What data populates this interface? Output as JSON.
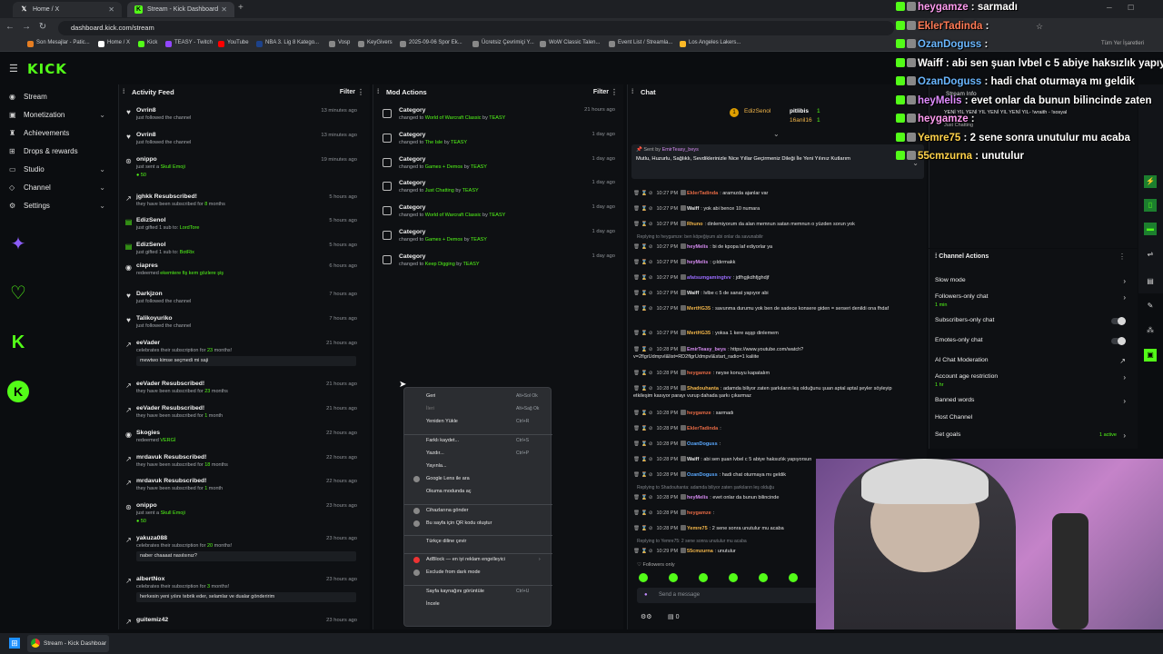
{
  "browser": {
    "tabs": [
      {
        "title": "Home / X",
        "icon": "x-icon",
        "active": false
      },
      {
        "title": "Stream - Kick Dashboard",
        "icon": "kick-icon",
        "active": true
      }
    ],
    "url": "dashboard.kick.com/stream",
    "bookmarks": [
      "Son Mesajlar - Patic...",
      "Home / X",
      "Kick",
      "TEASY - Twitch",
      "YouTube",
      "NBA 3. Lig 8 Katego...",
      "Vosp",
      "KeyGivers",
      "2025-09-06 Spor Ek...",
      "Ücretsiz Çevrimiçi Y...",
      "WoW Classic Talen...",
      "Event List / Streamla...",
      "Los Angeles Lakers..."
    ],
    "bookmarks_right": "Tüm Yer İşaretleri"
  },
  "app": {
    "logo": "KICK"
  },
  "sidebar": {
    "items": [
      {
        "label": "Stream",
        "icon": "stream-icon"
      },
      {
        "label": "Monetization",
        "icon": "money-icon"
      },
      {
        "label": "Achievements",
        "icon": "trophy-icon"
      },
      {
        "label": "Drops & rewards",
        "icon": "gift-icon"
      },
      {
        "label": "Studio",
        "icon": "studio-icon"
      },
      {
        "label": "Channel",
        "icon": "channel-icon"
      },
      {
        "label": "Settings",
        "icon": "gear-icon"
      }
    ]
  },
  "activity": {
    "title": "Activity Feed",
    "filter": "Filter",
    "items": [
      {
        "name": "Ovrin8",
        "sub": "just followed the channel",
        "time": "13 minutes ago",
        "icon": "heart"
      },
      {
        "name": "Ovrin8",
        "sub": "just followed the channel",
        "time": "13 minutes ago",
        "icon": "heart"
      },
      {
        "name": "onippo",
        "sub": "just sent a ",
        "hl": "Skull Emoji",
        "gift": "50",
        "time": "19 minutes ago",
        "icon": "kick"
      },
      {
        "name": "jghkk Resubscribed!",
        "sub": "they have been subscribed for ",
        "hl": "8",
        "sub2": " months",
        "time": "5 hours ago",
        "icon": "star"
      },
      {
        "name": "EdizSenol",
        "sub": "just gifted 1 sub to: ",
        "hl": "LordTore",
        "time": "5 hours ago",
        "icon": "gift"
      },
      {
        "name": "EdizSenol",
        "sub": "just gifted 1 sub to: ",
        "hl": "BotRix",
        "time": "5 hours ago",
        "icon": "gift"
      },
      {
        "name": "ciapres",
        "sub": "redeemed ",
        "hl": "ekemtere fiş kem gözlere şiş",
        "time": "6 hours ago",
        "icon": "redeem"
      },
      {
        "name": "Darkjzon",
        "sub": "just followed the channel",
        "time": "7 hours ago",
        "icon": "heart"
      },
      {
        "name": "Talikoyuriko",
        "sub": "just followed the channel",
        "time": "7 hours ago",
        "icon": "heart"
      },
      {
        "name": "eeVader",
        "sub": "celebrates their subscription for ",
        "hl": "23",
        "sub2": " months!",
        "msg": "mewtwo kimse seçmedi mi saji",
        "time": "21 hours ago",
        "icon": "star"
      },
      {
        "name": "eeVader Resubscribed!",
        "sub": "they have been subscribed for ",
        "hl": "23",
        "sub2": " months",
        "time": "21 hours ago",
        "icon": "star"
      },
      {
        "name": "eeVader Resubscribed!",
        "sub": "they have been subscribed for ",
        "hl": "1",
        "sub2": " month",
        "time": "21 hours ago",
        "icon": "star"
      },
      {
        "name": "Skogies",
        "sub": "redeemed ",
        "hl": "VERGİ",
        "time": "22 hours ago",
        "icon": "redeem"
      },
      {
        "name": "mrdavuk Resubscribed!",
        "sub": "they have been subscribed for ",
        "hl": "18",
        "sub2": " months",
        "time": "22 hours ago",
        "icon": "star"
      },
      {
        "name": "mrdavuk Resubscribed!",
        "sub": "they have been subscribed for ",
        "hl": "1",
        "sub2": " month",
        "time": "22 hours ago",
        "icon": "star"
      },
      {
        "name": "onippo",
        "sub": "just sent a ",
        "hl": "Skull Emoji",
        "gift": "50",
        "time": "23 hours ago",
        "icon": "kick"
      },
      {
        "name": "yakuza088",
        "sub": "celebrates their subscription for ",
        "hl": "20",
        "sub2": " months!",
        "msg": "naber chaaaat nasılsınız?",
        "time": "23 hours ago",
        "icon": "star"
      },
      {
        "name": "albertNox",
        "sub": "celebrates their subscription for ",
        "hl": "3",
        "sub2": " months!",
        "msg": "herkesin yeni yılını tebrik eder, selamlar ve dualar gönderirim",
        "time": "23 hours ago",
        "icon": "star"
      },
      {
        "name": "guitemiz42",
        "sub": "",
        "time": "23 hours ago",
        "icon": "star"
      }
    ]
  },
  "mod": {
    "title": "Mod Actions",
    "filter": "Filter",
    "items": [
      {
        "name": "Category",
        "pre": "changed to ",
        "cat": "World of Warcraft Classic",
        "by": " by ",
        "user": "TEASY",
        "time": "21 hours ago"
      },
      {
        "name": "Category",
        "pre": "changed to ",
        "cat": "The Isle",
        "by": " by ",
        "user": "TEASY",
        "time": "1 day ago"
      },
      {
        "name": "Category",
        "pre": "changed to ",
        "cat": "Games + Demos",
        "by": " by ",
        "user": "TEASY",
        "time": "1 day ago"
      },
      {
        "name": "Category",
        "pre": "changed to ",
        "cat": "Just Chatting",
        "by": " by ",
        "user": "TEASY",
        "time": "1 day ago"
      },
      {
        "name": "Category",
        "pre": "changed to ",
        "cat": "World of Warcraft Classic",
        "by": " by ",
        "user": "TEASY",
        "time": "1 day ago"
      },
      {
        "name": "Category",
        "pre": "changed to ",
        "cat": "Games + Demos",
        "by": " by ",
        "user": "TEASY",
        "time": "1 day ago"
      },
      {
        "name": "Category",
        "pre": "changed to ",
        "cat": "Keep Digging",
        "by": " by ",
        "user": "TEASY",
        "time": "1 day ago"
      }
    ]
  },
  "chat": {
    "title": "Chat",
    "pinned": {
      "sentby": "Sent by",
      "user": "EmirTeasy_beys",
      "text": "Mutlu, Huzurlu, Sağlıklı, Sevdiklerinizle Nice Yıllar Geçirmeniz Dileği İle Yeni Yılınız Kutlarım"
    },
    "top_users": {
      "a": "EdizSenol",
      "b": "pitlibis",
      "c": "16anil16",
      "n1": "1",
      "n2": "1"
    },
    "lines": [
      {
        "time": "10:27 PM",
        "user": "EklerTadinda",
        "color": "#e66a45",
        "text": "aramızda ajanlar var"
      },
      {
        "time": "10:27 PM",
        "user": "Waiff",
        "color": "#e6e6e6",
        "text": "yok abi bence 10 numara"
      },
      {
        "time": "10:27 PM",
        "user": "Rhuno",
        "color": "#f2b64a",
        "text": "dinlemiyorum da alan memnun satan memnun o yüzden sorun yok"
      },
      {
        "reply": "Replying to heygamze: ben köpeğiyum abi onlar da savunabilir"
      },
      {
        "time": "10:27 PM",
        "user": "heyMelis",
        "color": "#d58bf0",
        "text": "bi de kpopa laf ediyorlar ya"
      },
      {
        "time": "10:27 PM",
        "user": "heyMelis",
        "color": "#d58bf0",
        "text": "çıldırmakk"
      },
      {
        "time": "10:27 PM",
        "user": "afatsumgamingtvv",
        "color": "#9b6cff",
        "text": "jdfhgjkdhfjghdjf"
      },
      {
        "time": "10:27 PM",
        "user": "Waiff",
        "color": "#e6e6e6",
        "text": "lvlbe c 5 de sanat yapıyor abi"
      },
      {
        "time": "10:27 PM",
        "user": "MertHG35",
        "color": "#f2b64a",
        "text": "savunma durumu yok ben de sadece konsere giden = serseri denildi ona fhdaf"
      },
      {
        "time": "10:27 PM",
        "user": "MertHG35",
        "color": "#f2b64a",
        "text": "yoksa 1 kere aşşp dinlemem"
      },
      {
        "time": "10:28 PM",
        "user": "EmirTeasy_beys",
        "color": "#d58bf0",
        "text": "https://www.youtube.com/watch?v=2flgrUdmpvI&list=RD2flgrUdmpvI&start_radio=1 kaliite"
      },
      {
        "time": "10:28 PM",
        "user": "heygamze",
        "color": "#e66a45",
        "text": "neyse konuyu kapatalım"
      },
      {
        "time": "10:28 PM",
        "user": "Shadouhanta",
        "color": "#f2b64a",
        "text": "adamda biliyor zaten şarkıların leş olduğunu şuan aptal aptal şeyler söyleyip etkileşim kasıyor parayı vurup dahada şarkı çıkarmaz"
      },
      {
        "time": "10:28 PM",
        "user": "heygamze",
        "color": "#e66a45",
        "text": "sarmadı"
      },
      {
        "time": "10:28 PM",
        "user": "EklerTadinda",
        "color": "#e66a45",
        "text": ""
      },
      {
        "time": "10:28 PM",
        "user": "OzanDoguss",
        "color": "#5aa9ff",
        "text": ""
      },
      {
        "time": "10:28 PM",
        "user": "Waiff",
        "color": "#e6e6e6",
        "text": "abi sen şuan lvbel c 5 abiye haksızlık yapıyorsun"
      },
      {
        "time": "10:28 PM",
        "user": "OzanDoguss",
        "color": "#5aa9ff",
        "text": "hadi chat oturmaya mı geldik"
      },
      {
        "reply": "Replying to Shadouhanta: adamda biliyor zaten şarkıların leş olduğu"
      },
      {
        "time": "10:28 PM",
        "user": "heyMelis",
        "color": "#d58bf0",
        "text": "evet onlar da bunun bilincinde"
      },
      {
        "time": "10:28 PM",
        "user": "heygamze",
        "color": "#e66a45",
        "text": ""
      },
      {
        "time": "10:28 PM",
        "user": "Yemre75",
        "color": "#f2b64a",
        "text": "2 sene sonra unutulur mu acaba"
      },
      {
        "reply": "Replying to Yemre75: 2 sene sonra unutulur mu acaba"
      },
      {
        "time": "10:29 PM",
        "user": "55cmzurna",
        "color": "#f2b64a",
        "text": "unutulur"
      }
    ],
    "mode": "Followers only",
    "placeholder": "Send a message",
    "count": "0"
  },
  "context_menu": {
    "items": [
      {
        "label": "Geri",
        "key": "Alt+Sol Ok",
        "dim": false
      },
      {
        "label": "İleri",
        "key": "Alt+Sağ Ok",
        "dim": true
      },
      {
        "label": "Yeniden Yükle",
        "key": "Ctrl+R",
        "dim": false
      },
      {
        "sep": true
      },
      {
        "label": "Farklı kaydet...",
        "key": "Ctrl+S"
      },
      {
        "label": "Yazdır...",
        "key": "Ctrl+P"
      },
      {
        "label": "Yayınla..."
      },
      {
        "label": "Google Lens ile ara",
        "icon": true
      },
      {
        "label": "Okuma modunda aç"
      },
      {
        "sep": true
      },
      {
        "label": "Cihazlarına gönder",
        "icon": true
      },
      {
        "label": "Bu sayfa için QR kodu oluştur",
        "icon": true
      },
      {
        "sep": true
      },
      {
        "label": "Türkçe diline çevir"
      },
      {
        "sep": true
      },
      {
        "label": "AdBlock — en iyi reklam engelleyici",
        "icon": true,
        "sub": true
      },
      {
        "label": "Exclude from dark mode",
        "icon": true
      },
      {
        "sep": true
      },
      {
        "label": "Sayfa kaynağını görüntüle",
        "key": "Ctrl+U"
      },
      {
        "label": "İncele"
      }
    ]
  },
  "stream_info": {
    "label": "Stream Info",
    "title": "YENİ YIL YENİ YIL YENİ YIL YENİ YIL- !wraith - !sosyal",
    "category": "Just Chatting",
    "player": "player"
  },
  "channel_actions": {
    "title": "Channel Actions",
    "items": [
      {
        "label": "Slow mode",
        "type": "arrow"
      },
      {
        "label": "Followers-only chat",
        "sub": "1 min",
        "type": "arrow"
      },
      {
        "label": "Subscribers-only chat",
        "type": "toggle"
      },
      {
        "label": "Emotes-only chat",
        "type": "toggle"
      },
      {
        "label": "AI Chat Moderation",
        "type": "link"
      },
      {
        "label": "Account age restriction",
        "sub": "1 hr",
        "type": "arrow"
      },
      {
        "label": "Banned words",
        "type": "arrow"
      },
      {
        "label": "Host Channel",
        "type": "none"
      },
      {
        "label": "Set goals",
        "type": "arrow",
        "extra": "1 active"
      }
    ]
  },
  "overlay_chat": [
    {
      "user": "heygamze",
      "color": "#ff9cf0",
      "text": "sarmadı"
    },
    {
      "user": "EklerTadinda",
      "color": "#ff7a55",
      "text": ""
    },
    {
      "user": "OzanDoguss",
      "color": "#6ab7ff",
      "text": ""
    },
    {
      "user": "Waiff",
      "color": "#ffffff",
      "text": "abi sen şuan lvbel c 5 abiye haksızlık yapıyorsun"
    },
    {
      "user": "OzanDoguss",
      "color": "#6ab7ff",
      "text": "hadi chat oturmaya mı geldik"
    },
    {
      "user": "heyMelis",
      "color": "#e08cff",
      "text": "evet onlar da bunun bilincinde zaten"
    },
    {
      "user": "heygamze",
      "color": "#ff9cf0",
      "text": ""
    },
    {
      "user": "Yemre75",
      "color": "#ffd24a",
      "text": "2 sene sonra unutulur mu acaba"
    },
    {
      "user": "55cmzurna",
      "color": "#ffd24a",
      "text": "unutulur"
    }
  ],
  "taskbar": {
    "window": "Stream - Kick Dashboar"
  },
  "colors": {
    "accent": "#53fc18",
    "bg": "#0b0d10",
    "panel": "#0e1013"
  }
}
